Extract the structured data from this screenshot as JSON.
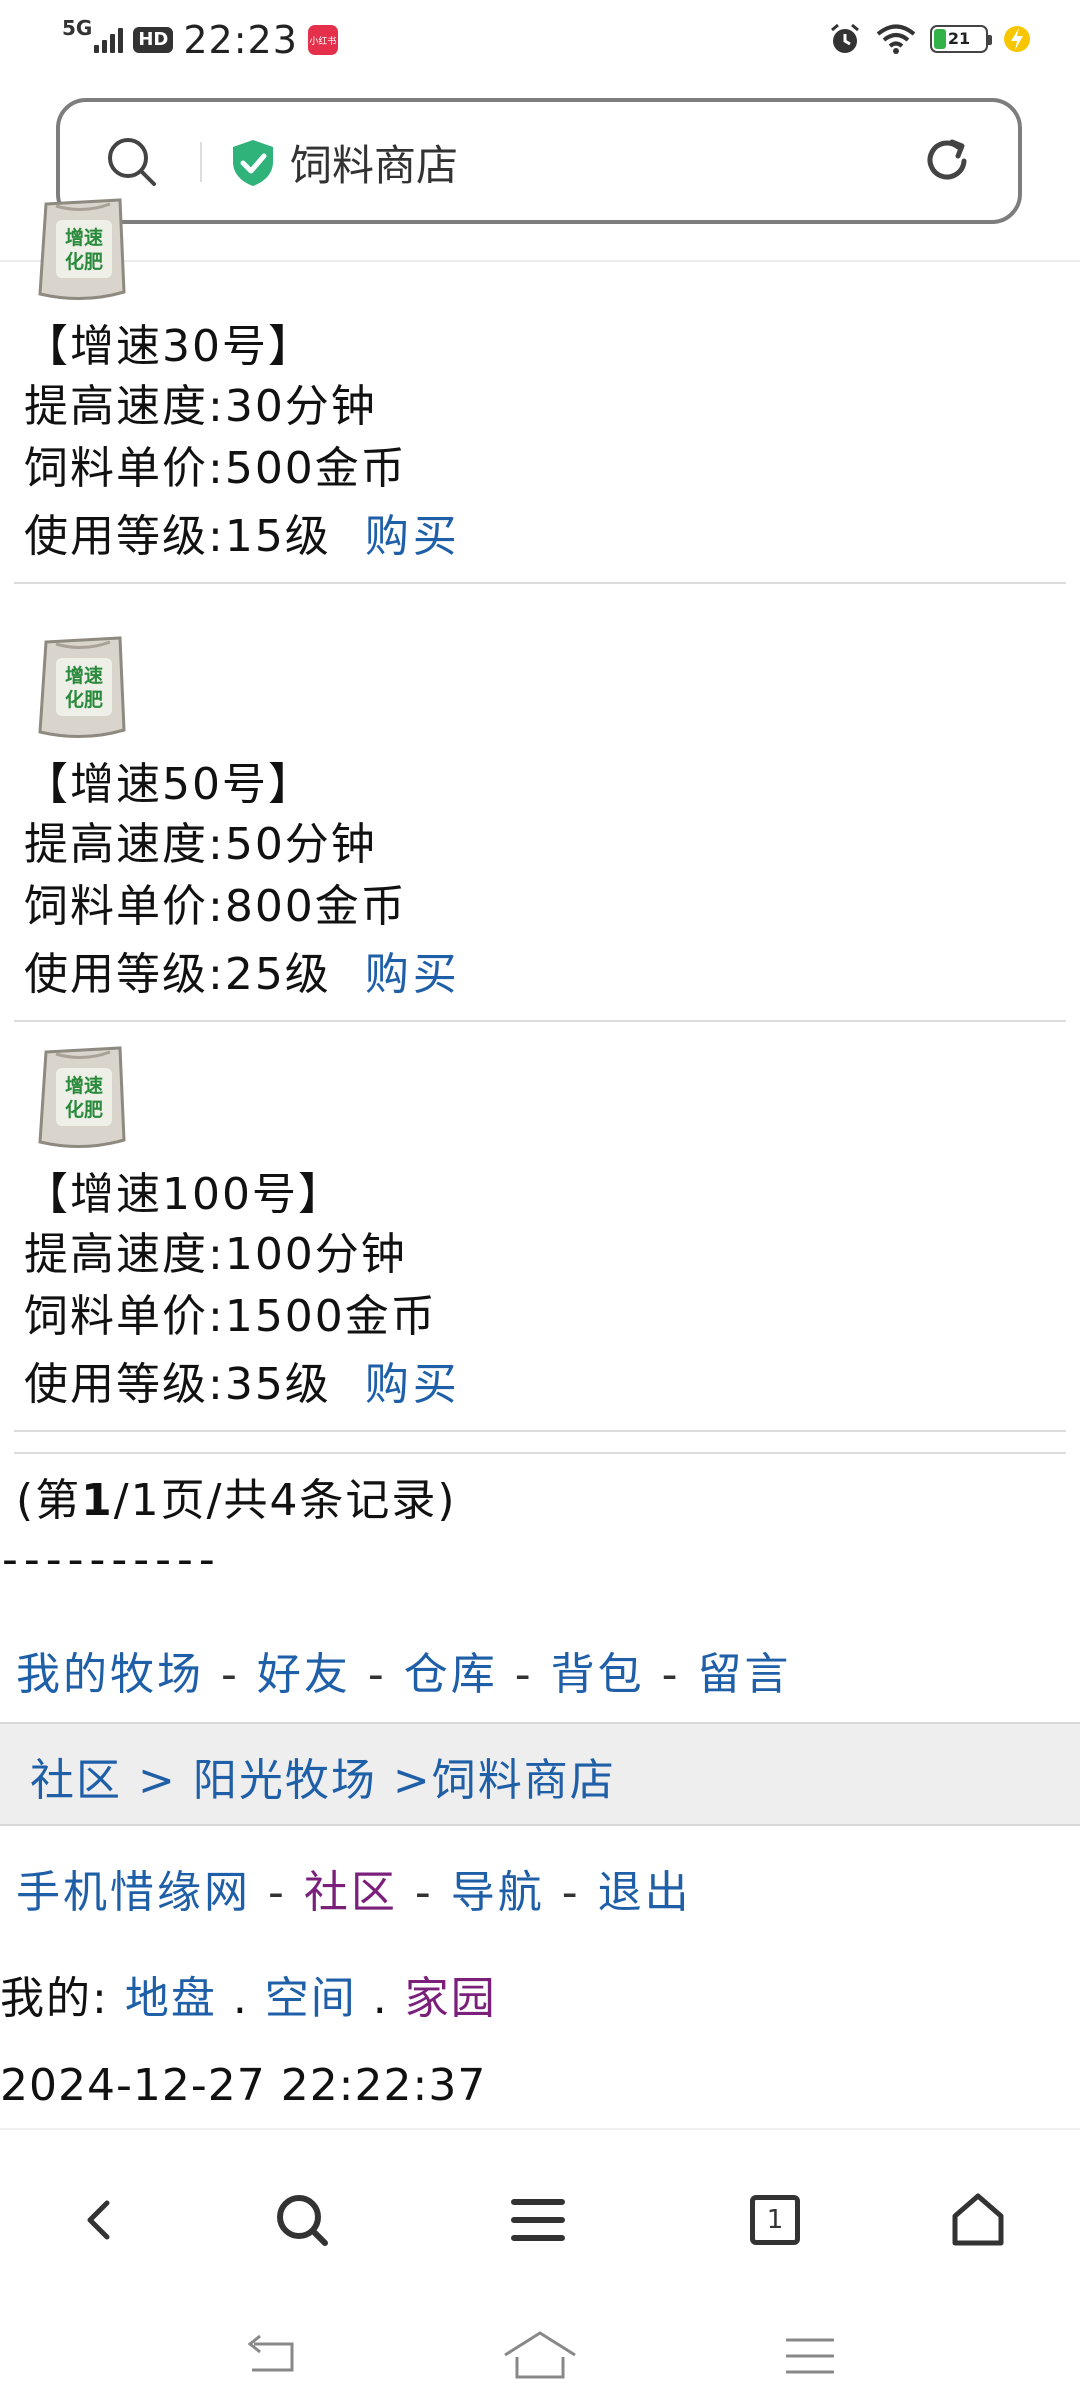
{
  "status_bar": {
    "network": "5G",
    "hd": "HD",
    "time": "22:23",
    "app_badge": "小红书",
    "battery": "21",
    "icons": [
      "signal-icon",
      "alarm-icon",
      "wifi-icon",
      "battery-icon",
      "charging-icon"
    ]
  },
  "address_bar": {
    "title": "饲料商店",
    "icons": [
      "search-icon",
      "shield-check-icon",
      "reload-icon"
    ]
  },
  "items": [
    {
      "bag_text": "增速化肥",
      "name": "【增速30号】",
      "speed": "提高速度:30分钟",
      "price": "饲料单价:500金币",
      "level": "使用等级:15级",
      "buy": "购买"
    },
    {
      "bag_text": "增速化肥",
      "name": "【增速50号】",
      "speed": "提高速度:50分钟",
      "price": "饲料单价:800金币",
      "level": "使用等级:25级",
      "buy": "购买"
    },
    {
      "bag_text": "增速化肥",
      "name": "【增速100号】",
      "speed": "提高速度:100分钟",
      "price": "饲料单价:1500金币",
      "level": "使用等级:35级",
      "buy": "购买"
    }
  ],
  "pagination": {
    "open": "(第",
    "current": "1",
    "rest": "/1页/共4条记录)"
  },
  "dashes": "----------",
  "ranch_nav": [
    "我的牧场",
    "好友",
    "仓库",
    "背包",
    "留言"
  ],
  "nav_separator": " - ",
  "breadcrumb": {
    "community": "社区",
    "gt1": " > ",
    "ranch": "阳光牧场",
    "gt2": " >",
    "shop": "饲料商店"
  },
  "site_nav": [
    "手机惜缘网",
    "社区",
    "导航",
    "退出"
  ],
  "mine": {
    "label": "我的:",
    "links": [
      "地盘",
      "空间",
      "家园"
    ],
    "dot": " . "
  },
  "timestamp": "2024-12-27 22:22:37",
  "toolbar": {
    "tab_count": "1",
    "icons": [
      "back-icon",
      "search-icon",
      "menu-icon",
      "tabs-icon",
      "home-icon"
    ]
  },
  "colors": {
    "link": "#1f5fa8",
    "visited": "#7a1f7a",
    "shield": "#2fb37a"
  }
}
